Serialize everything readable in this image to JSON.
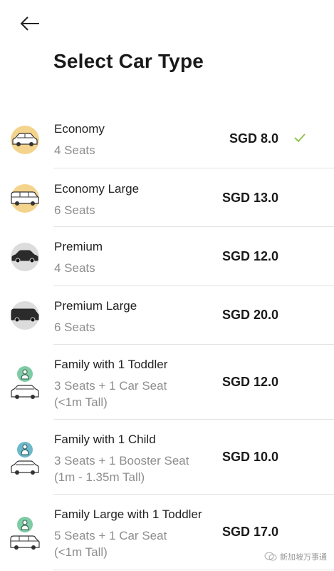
{
  "header": {
    "title": "Select Car Type",
    "back_icon": "arrow-left-icon"
  },
  "colors": {
    "economy_circle": "#f4d48d",
    "premium_circle": "#dcdcdc",
    "family_circle": "#7ecba6",
    "child_circle": "#6bb9c9",
    "check": "#8bbf3f",
    "divider": "#e3e3e3"
  },
  "car_types": [
    {
      "name": "Economy",
      "seats": "4 Seats",
      "note": "",
      "price": "SGD 8.0",
      "selected": true,
      "icon": "economy-car-icon"
    },
    {
      "name": "Economy Large",
      "seats": "6 Seats",
      "note": "",
      "price": "SGD 13.0",
      "selected": false,
      "icon": "economy-large-car-icon"
    },
    {
      "name": "Premium",
      "seats": "4 Seats",
      "note": "",
      "price": "SGD 12.0",
      "selected": false,
      "icon": "premium-car-icon"
    },
    {
      "name": "Premium Large",
      "seats": "6 Seats",
      "note": "",
      "price": "SGD 20.0",
      "selected": false,
      "icon": "premium-large-car-icon"
    },
    {
      "name": "Family with 1 Toddler",
      "seats": "3 Seats + 1 Car Seat",
      "note": "(<1m Tall)",
      "price": "SGD 12.0",
      "selected": false,
      "icon": "toddler-car-icon"
    },
    {
      "name": "Family with 1 Child",
      "seats": "3 Seats + 1 Booster Seat",
      "note": "(1m - 1.35m Tall)",
      "price": "SGD 10.0",
      "selected": false,
      "icon": "child-car-icon"
    },
    {
      "name": "Family Large with 1 Toddler",
      "seats": "5 Seats + 1 Car Seat",
      "note": "(<1m Tall)",
      "price": "SGD 17.0",
      "selected": false,
      "icon": "toddler-large-car-icon"
    }
  ],
  "watermark": {
    "text": "新加坡万事通"
  }
}
